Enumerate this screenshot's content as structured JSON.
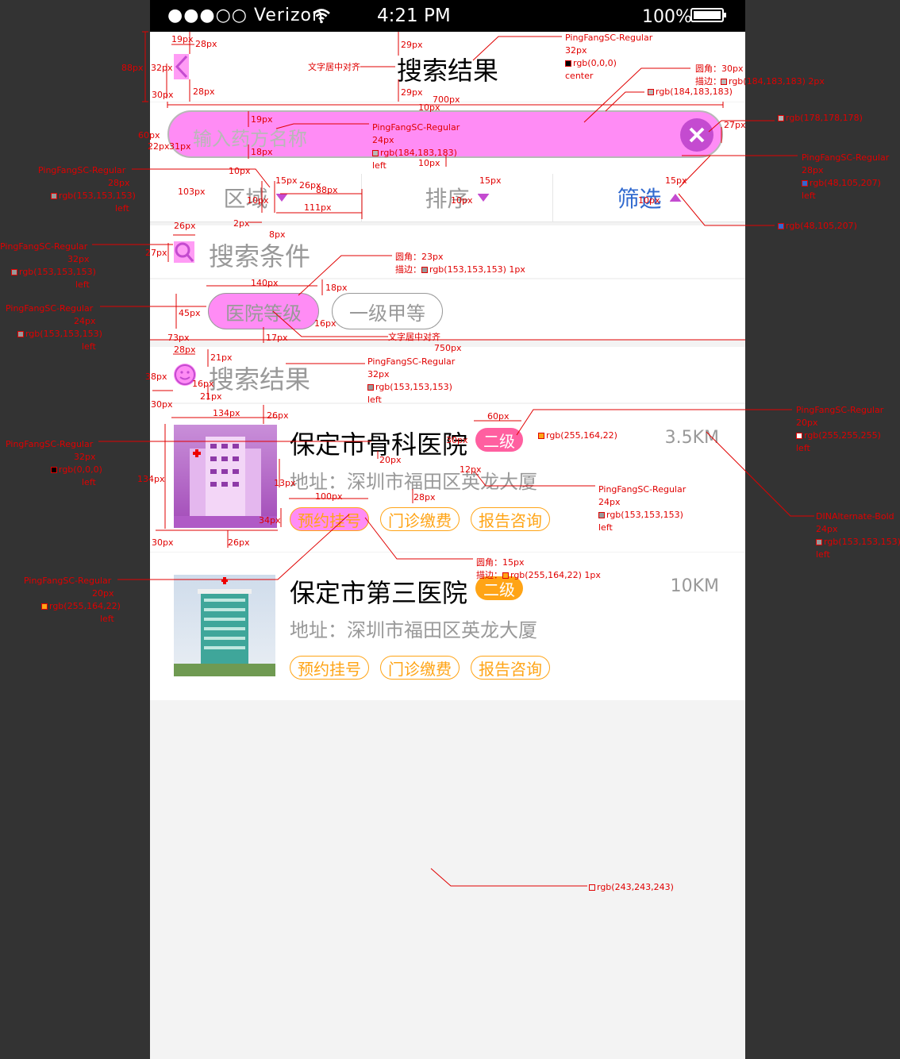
{
  "status_bar": {
    "carrier": "●●●○○ Verizon",
    "time": "4:21 PM",
    "battery": "100%"
  },
  "nav": {
    "title": "搜索结果",
    "back_icon": "chevron-left-icon"
  },
  "search": {
    "placeholder": "输入药方名称",
    "clear_icon": "close-circle-icon"
  },
  "filters": [
    {
      "label": "区域",
      "active": false
    },
    {
      "label": "排序",
      "active": false
    },
    {
      "label": "筛选",
      "active": true
    }
  ],
  "conditions": {
    "heading": "搜索条件",
    "icon": "search-icon",
    "chips": [
      "医院等级",
      "一级甲等"
    ]
  },
  "results": {
    "heading": "搜索结果",
    "icon": "smile-icon"
  },
  "hospitals": [
    {
      "name": "保定市骨科医院",
      "level": "二级",
      "address": "地址：深圳市福田区英龙大厦",
      "distance": "3.5KM",
      "actions": [
        "预约挂号",
        "门诊缴费",
        "报告咨询"
      ]
    },
    {
      "name": "保定市第三医院",
      "level": "二级",
      "address": "地址：深圳市福田区英龙大厦",
      "distance": "10KM",
      "actions": [
        "预约挂号",
        "门诊缴费",
        "报告咨询"
      ]
    }
  ],
  "colors": {
    "page_bg": "#f3f3f3",
    "accent_orange": "#ffa416",
    "filter_active": "#3069cf",
    "gray_text": "#999999",
    "border_gray": "#b8b7b7"
  },
  "annotations": [
    "19px",
    "28px",
    "88px",
    "32px",
    "30px",
    "28px",
    "29px",
    "文字居中对齐",
    "29px",
    "PingFangSC-Regular",
    "32px",
    "rgb(0,0,0)",
    "center",
    "圆角：30px",
    "描边：",
    "rgb(184,183,183)  2px",
    "rgb(184,183,183)",
    "700px",
    "10px",
    "rgb(178,178,178)",
    "27px",
    "19px",
    "60px",
    "PingFangSC-Regular",
    "24px",
    "rgb(184,183,183)",
    "left",
    "22px",
    "31px",
    "18px",
    "10px",
    "PingFangSC-Regular",
    "28px",
    "rgb(48,105,207)",
    "left",
    "PingFangSC-Regular",
    "28px",
    "rgb(153,153,153)",
    "left",
    "10px",
    "15px",
    "26px",
    "88px",
    "103px",
    "10px",
    "111px",
    "15px",
    "10px",
    "15px",
    "10px",
    "rgb(48,105,207)",
    "2px",
    "8px",
    "26px",
    "27px",
    "PingFangSC-Regular",
    "32px",
    "rgb(153,153,153)",
    "left",
    "圆角：23px",
    "描边：",
    "rgb(153,153,153)  1px",
    "140px",
    "18px",
    "45px",
    "16px",
    "PingFangSC-Regular",
    "24px",
    "rgb(153,153,153)",
    "left",
    "73px",
    "17px",
    "文字居中对齐",
    "750px",
    "28px",
    "21px",
    "PingFangSC-Regular",
    "32px",
    "rgb(153,153,153)",
    "left",
    "38px",
    "16px",
    "21px",
    "30px",
    "134px",
    "26px",
    "60px",
    "PingFangSC-Regular",
    "20px",
    "rgb(255,255,255)",
    "left",
    "rgb(255,164,22)",
    "30px",
    "20px",
    "12px",
    "PingFangSC-Regular",
    "32px",
    "rgb(0,0,0)",
    "left",
    "134px",
    "13px",
    "PingFangSC-Regular",
    "24px",
    "rgb(153,153,153)",
    "left",
    "DINAlternate-Bold",
    "24px",
    "rgb(153,153,153)",
    "left",
    "28px",
    "100px",
    "34px",
    "30px",
    "26px",
    "圆角：15px",
    "描边：",
    "rgb(255,164,22)  1px",
    "PingFangSC-Regular",
    "20px",
    "rgb(255,164,22)",
    "left",
    "rgb(243,243,243)"
  ]
}
